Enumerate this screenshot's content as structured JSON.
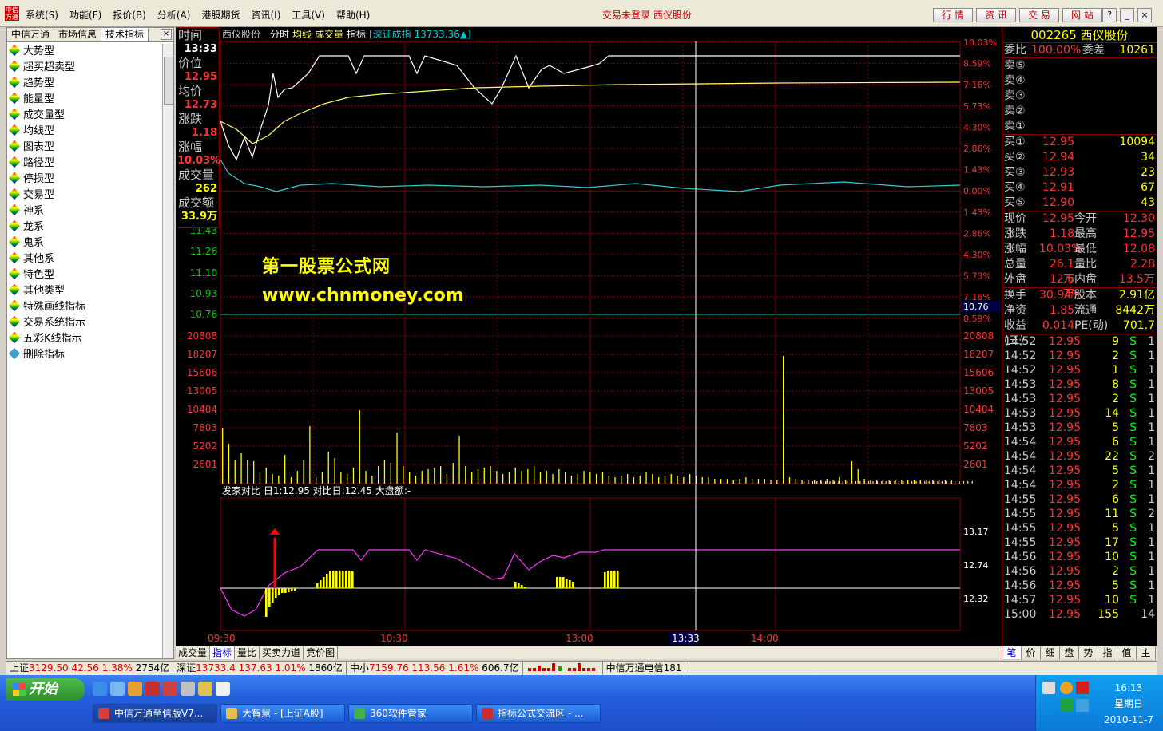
{
  "menu": {
    "items": [
      "系统(S)",
      "功能(F)",
      "报价(B)",
      "分析(A)",
      "港股期货",
      "资讯(I)",
      "工具(V)",
      "帮助(H)"
    ],
    "login_status": "交易未登录  西仪股份",
    "quick": [
      "行 情",
      "资 讯",
      "交 易",
      "网 站"
    ]
  },
  "left": {
    "tabs": [
      "中信万通",
      "市场信息",
      "技术指标"
    ],
    "items": [
      "大势型",
      "超买超卖型",
      "趋势型",
      "能量型",
      "成交量型",
      "均线型",
      "图表型",
      "路径型",
      "停损型",
      "交易型",
      "神系",
      "龙系",
      "鬼系",
      "其他系",
      "特色型",
      "其他类型",
      "特殊画线指标",
      "交易系统指示",
      "五彩K线指示",
      "删除指标"
    ]
  },
  "chart": {
    "header": {
      "name": "西仪股份",
      "items": [
        "分时",
        "均线",
        "成交量",
        "指标"
      ],
      "index": "[深证成指 13733.36▲]"
    },
    "info": {
      "time_label": "时间",
      "time": "13:33",
      "price_label": "价位",
      "price": "12.95",
      "avg_label": "均价",
      "avg": "12.73",
      "chg_label": "涨跌",
      "chg": "1.18",
      "pct_label": "涨幅",
      "pct": "10.03%",
      "vol_label": "成交量",
      "vol": "262",
      "amt_label": "成交额",
      "amt": "33.9万"
    },
    "price_left": [
      "11.43",
      "11.26",
      "11.10",
      "10.93",
      "10.76"
    ],
    "pct_right": [
      "10.03%",
      "8.59%",
      "7.16%",
      "5.73%",
      "4.30%",
      "2.86%",
      "1.43%",
      "0.00%",
      "1.43%",
      "2.86%",
      "4.30%",
      "5.73%",
      "7.16%",
      "8.59%"
    ],
    "highlight_price": "10.76",
    "vol_ticks": [
      "20808",
      "18207",
      "15606",
      "13005",
      "10404",
      "7803",
      "5202",
      "2601"
    ],
    "indicator_header": "发家对比  日1:12.95  对比日:12.45  大盘额:-",
    "ind_ticks": [
      "13.17",
      "12.74",
      "12.32"
    ],
    "time_ticks": [
      "09:30",
      "10:30",
      "13:00",
      "14:00"
    ],
    "cursor_time": "13:33",
    "colors": {
      "price": "#ffffff",
      "avg": "#ffff66",
      "index": "#33cccc",
      "magenta": "#ff33ff",
      "bar": "#ffff00",
      "grid": "#800000"
    }
  },
  "watermark": {
    "line1": "第一股票公式网",
    "line2": "www.chnmoney.com"
  },
  "bottom_tabs": [
    "成交量",
    "指标",
    "量比",
    "买卖力道",
    "竞价图"
  ],
  "right": {
    "title": "002265 西仪股份",
    "weibi_label": "委比",
    "weibi": "100.00%",
    "weicha_label": "委差",
    "weicha": "10261",
    "sells": [
      "卖⑤",
      "卖④",
      "卖③",
      "卖②",
      "卖①"
    ],
    "buys": [
      {
        "l": "买①",
        "p": "12.95",
        "v": "10094"
      },
      {
        "l": "买②",
        "p": "12.94",
        "v": "34"
      },
      {
        "l": "买③",
        "p": "12.93",
        "v": "23"
      },
      {
        "l": "买④",
        "p": "12.91",
        "v": "67"
      },
      {
        "l": "买⑤",
        "p": "12.90",
        "v": "43"
      }
    ],
    "stats": [
      {
        "a": "现价",
        "b": "12.95",
        "c": "今开",
        "d": "12.30"
      },
      {
        "a": "涨跌",
        "b": "1.18",
        "c": "最高",
        "d": "12.95"
      },
      {
        "a": "涨幅",
        "b": "10.03%",
        "c": "最低",
        "d": "12.08"
      },
      {
        "a": "总量",
        "b": "26.1万",
        "c": "量比",
        "d": "2.28"
      },
      {
        "a": "外盘",
        "b": "12.6万",
        "c": "内盘",
        "d": "13.5万"
      }
    ],
    "stats2": [
      {
        "a": "换手",
        "b": "30.94%",
        "c": "股本",
        "d": "2.91亿"
      },
      {
        "a": "净资",
        "b": "1.85",
        "c": "流通",
        "d": "8442万"
      },
      {
        "a": "收益(三)",
        "b": "0.014",
        "c": "PE(动)",
        "d": "701.7"
      }
    ],
    "ticks": [
      [
        "14:52",
        "12.95",
        "9",
        "S",
        "1"
      ],
      [
        "14:52",
        "12.95",
        "2",
        "S",
        "1"
      ],
      [
        "14:52",
        "12.95",
        "1",
        "S",
        "1"
      ],
      [
        "14:53",
        "12.95",
        "8",
        "S",
        "1"
      ],
      [
        "14:53",
        "12.95",
        "2",
        "S",
        "1"
      ],
      [
        "14:53",
        "12.95",
        "14",
        "S",
        "1"
      ],
      [
        "14:53",
        "12.95",
        "5",
        "S",
        "1"
      ],
      [
        "14:54",
        "12.95",
        "6",
        "S",
        "1"
      ],
      [
        "14:54",
        "12.95",
        "22",
        "S",
        "2"
      ],
      [
        "14:54",
        "12.95",
        "5",
        "S",
        "1"
      ],
      [
        "14:54",
        "12.95",
        "2",
        "S",
        "1"
      ],
      [
        "14:55",
        "12.95",
        "6",
        "S",
        "1"
      ],
      [
        "14:55",
        "12.95",
        "11",
        "S",
        "2"
      ],
      [
        "14:55",
        "12.95",
        "5",
        "S",
        "1"
      ],
      [
        "14:55",
        "12.95",
        "17",
        "S",
        "1"
      ],
      [
        "14:56",
        "12.95",
        "10",
        "S",
        "1"
      ],
      [
        "14:56",
        "12.95",
        "2",
        "S",
        "1"
      ],
      [
        "14:56",
        "12.95",
        "5",
        "S",
        "1"
      ],
      [
        "14:57",
        "12.95",
        "10",
        "S",
        "1"
      ],
      [
        "15:00",
        "12.95",
        "155",
        "",
        "14"
      ]
    ],
    "tabs": [
      "笔",
      "价",
      "细",
      "盘",
      "势",
      "指",
      "值",
      "主"
    ]
  },
  "status": {
    "sh": "上证",
    "sh_v": "3129.50",
    "sh_c": "42.56",
    "sh_p": "1.38%",
    "sh_a": "2754亿",
    "sz": "深证",
    "sz_v": "13733.4",
    "sz_c": "137.63",
    "sz_p": "1.01%",
    "sz_a": "1860亿",
    "zx": "中小",
    "zx_v": "7159.76",
    "zx_c": "113.56",
    "zx_p": "1.61%",
    "zx_a": "606.7亿",
    "broker": "中信万通电信181"
  },
  "taskbar": {
    "start": "开始",
    "tasks": [
      "中信万通至信版V7...",
      "大智慧 - [上证A股]",
      "360软件管家",
      "指标公式交流区 - ..."
    ],
    "time": "16:13",
    "weekday": "星期日",
    "date": "2010-11-7"
  }
}
